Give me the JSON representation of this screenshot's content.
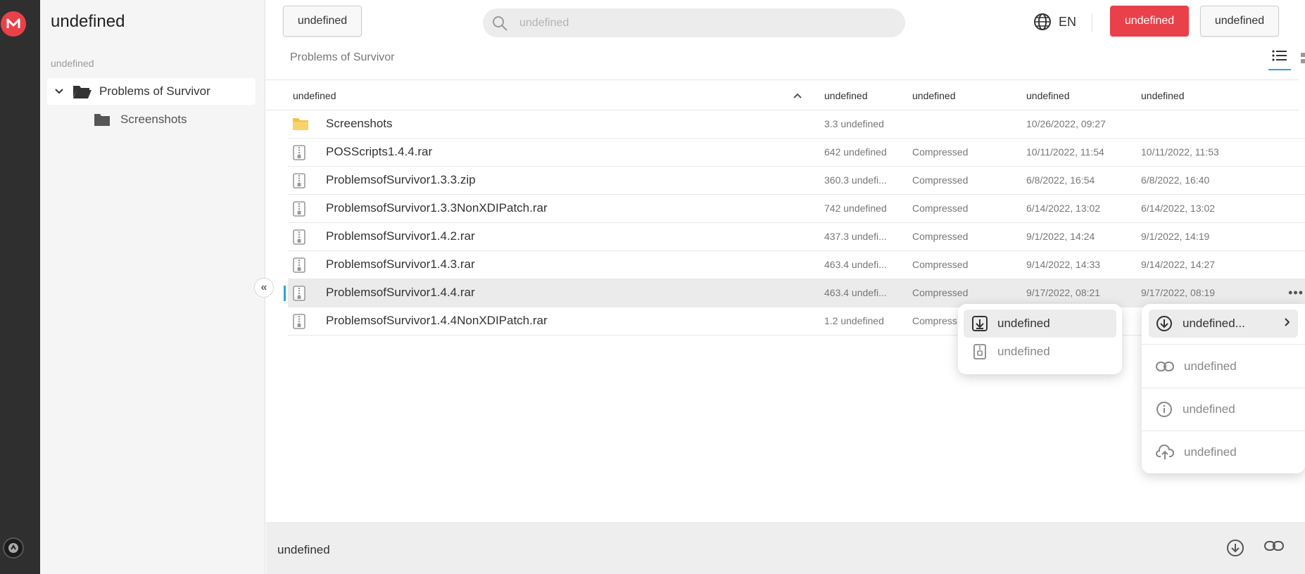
{
  "app": {
    "logo_letter": "M"
  },
  "sidebar": {
    "title": "undefined",
    "section_label": "undefined",
    "tree": {
      "root_label": "Problems of Survivor",
      "child_label": "Screenshots"
    }
  },
  "topbar": {
    "left_button": "undefined",
    "search_placeholder": "undefined",
    "language": "EN",
    "primary_button": "undefined",
    "secondary_button": "undefined"
  },
  "breadcrumb": "Problems of Survivor",
  "table": {
    "headers": [
      "undefined",
      "undefined",
      "undefined",
      "undefined",
      "undefined"
    ],
    "rows": [
      {
        "name": "Screenshots",
        "type": "folder",
        "size": "3.3 undefined",
        "kind": "",
        "modified": "10/26/2022, 09:27",
        "added": ""
      },
      {
        "name": "POSScripts1.4.4.rar",
        "type": "archive",
        "size": "642 undefined",
        "kind": "Compressed",
        "modified": "10/11/2022, 11:54",
        "added": "10/11/2022, 11:53"
      },
      {
        "name": "ProblemsofSurvivor1.3.3.zip",
        "type": "archive",
        "size": "360.3 undefi...",
        "kind": "Compressed",
        "modified": "6/8/2022, 16:54",
        "added": "6/8/2022, 16:40"
      },
      {
        "name": "ProblemsofSurvivor1.3.3NonXDIPatch.rar",
        "type": "archive",
        "size": "742 undefined",
        "kind": "Compressed",
        "modified": "6/14/2022, 13:02",
        "added": "6/14/2022, 13:02"
      },
      {
        "name": "ProblemsofSurvivor1.4.2.rar",
        "type": "archive",
        "size": "437.3 undefi...",
        "kind": "Compressed",
        "modified": "9/1/2022, 14:24",
        "added": "9/1/2022, 14:19"
      },
      {
        "name": "ProblemsofSurvivor1.4.3.rar",
        "type": "archive",
        "size": "463.4 undefi...",
        "kind": "Compressed",
        "modified": "9/14/2022, 14:33",
        "added": "9/14/2022, 14:27"
      },
      {
        "name": "ProblemsofSurvivor1.4.4.rar",
        "type": "archive",
        "size": "463.4 undefi...",
        "kind": "Compressed",
        "modified": "9/17/2022, 08:21",
        "added": "9/17/2022, 08:19",
        "selected": true
      },
      {
        "name": "ProblemsofSurvivor1.4.4NonXDIPatch.rar",
        "type": "archive",
        "size": "1.2 undefined",
        "kind": "Compress",
        "modified": "",
        "added": ""
      }
    ]
  },
  "submenu": {
    "items": [
      {
        "label": "undefined",
        "icon": "download-box-icon"
      },
      {
        "label": "undefined",
        "icon": "zip-file-icon"
      }
    ]
  },
  "context_menu": {
    "items": [
      {
        "label": "undefined...",
        "icon": "download-circle-icon"
      },
      {
        "label": "undefined",
        "icon": "link-icon"
      },
      {
        "label": "undefined",
        "icon": "info-icon"
      },
      {
        "label": "undefined",
        "icon": "cloud-upload-icon"
      }
    ]
  },
  "bottom_bar": {
    "text": "undefined"
  },
  "colors": {
    "accent": "#2aa7d6",
    "brand": "#e9414a",
    "folder_yellow": "#f5c242"
  }
}
